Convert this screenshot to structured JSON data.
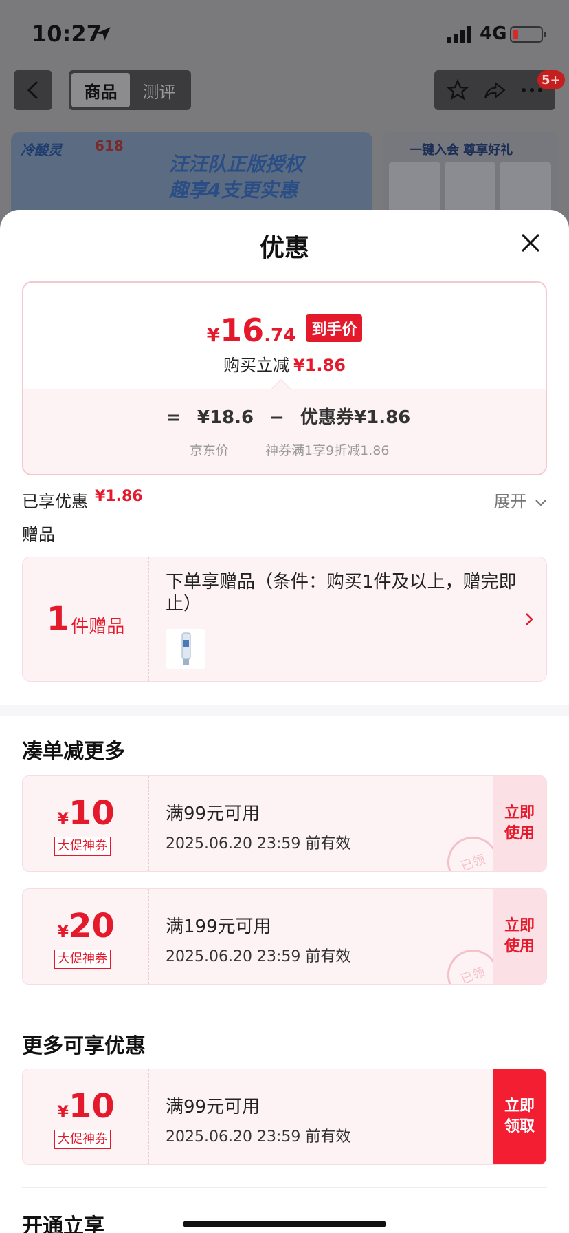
{
  "status": {
    "time": "10:27",
    "network": "4G",
    "battery_level": 0.18
  },
  "nav": {
    "tabs": [
      "商品",
      "测评"
    ],
    "active_tab": 0,
    "badge": "5+"
  },
  "banner": {
    "brand": "冷酸灵",
    "badge_618": "618",
    "headline_1": "汪汪队正版授权",
    "headline_2": "趣享4支更实惠",
    "right_title": "一键入会 尊享好礼"
  },
  "sheet": {
    "title": "优惠",
    "price": {
      "yen": "¥",
      "integer": "16",
      "decimal": ".74",
      "tag": "到手价",
      "buy_less_label": "购买立减",
      "buy_less_value": "¥1.86",
      "formula_equals": "=",
      "jd_price": "¥18.6",
      "minus": "−",
      "coupon_label": "优惠券¥1.86",
      "jd_price_caption": "京东价",
      "coupon_caption": "神券满1享9折减1.86"
    },
    "enjoyed_label": "已享优惠",
    "enjoyed_value": "¥1.86",
    "expand_label": "展开",
    "gift_section": "赠品",
    "gift": {
      "count": "1",
      "unit": "件赠品",
      "description": "下单享赠品（条件：购买1件及以上，赠完即止）"
    },
    "section_more": "凑单减更多",
    "coupons_more": [
      {
        "yen": "¥",
        "amount": "10",
        "type": "大促神券",
        "condition": "满99元可用",
        "expiry": "2025.06.20 23:59 前有效",
        "action": "立即使用",
        "stamp": "已领"
      },
      {
        "yen": "¥",
        "amount": "20",
        "type": "大促神券",
        "condition": "满199元可用",
        "expiry": "2025.06.20 23:59 前有效",
        "action": "立即使用",
        "stamp": "已领"
      }
    ],
    "section_extra": "更多可享优惠",
    "coupons_extra": [
      {
        "yen": "¥",
        "amount": "10",
        "type": "大促神券",
        "condition": "满99元可用",
        "expiry": "2025.06.20 23:59 前有效",
        "action": "立即领取"
      }
    ],
    "section_open": "开通立享"
  },
  "colors": {
    "accent": "#e4192b",
    "coupon_bg": "#fdf3f4",
    "action_bg": "#fbe1e6"
  }
}
